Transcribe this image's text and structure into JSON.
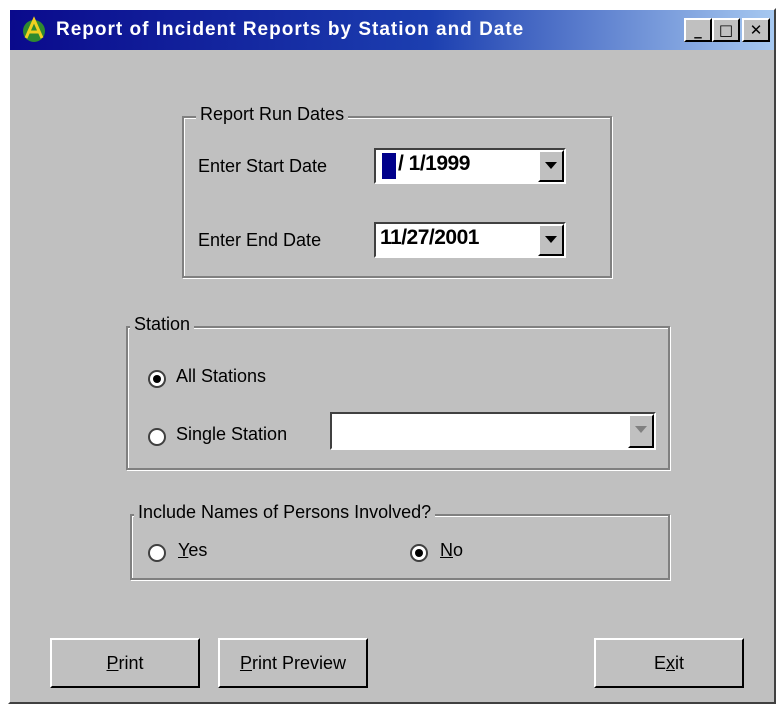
{
  "window": {
    "title": "Report of Incident Reports by Station and Date",
    "minimize_label": "_",
    "maximize_label": "□",
    "close_label": "✕",
    "icon": "app-icon"
  },
  "report_dates": {
    "legend": "Report Run Dates",
    "start_label": "Enter Start Date",
    "start_value": "/ 1/1999",
    "end_label": "Enter End Date",
    "end_value": "11/27/2001"
  },
  "station": {
    "legend": "Station",
    "all_label": "All Stations",
    "single_label": "Single Station",
    "single_value": ""
  },
  "names": {
    "legend": "Include Names of Persons Involved?",
    "yes_mnemonic": "Y",
    "yes_rest": "es",
    "no_mnemonic": "N",
    "no_rest": "o",
    "selected": "No"
  },
  "buttons": {
    "print_mnemonic": "P",
    "print_rest": "rint",
    "preview_mnemonic": "P",
    "preview_rest": "rint Preview",
    "exit_pre": "E",
    "exit_mnemonic": "x",
    "exit_rest": "it"
  },
  "colors": {
    "face": "#c0c0c0",
    "title_start": "#0a0a8c",
    "title_end": "#a6c8f0",
    "selection": "#00008b"
  }
}
